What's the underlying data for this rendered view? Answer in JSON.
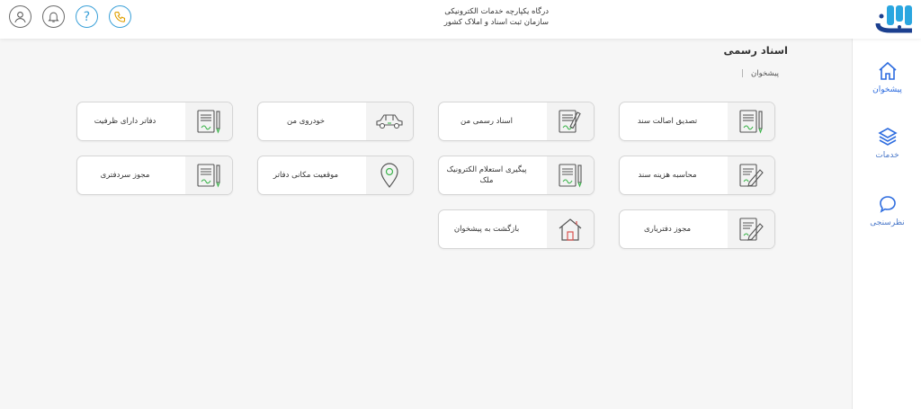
{
  "header": {
    "title_line1": "درگاه یکپارچه خدمات الکترونیکی",
    "title_line2": "سازمان ثبت اسناد و املاک کشور",
    "icons": [
      "user-icon",
      "bell-icon",
      "help-icon",
      "phone-icon"
    ]
  },
  "sidebar": {
    "items": [
      {
        "label": "پیشخوان",
        "icon": "home-icon"
      },
      {
        "label": "خدمات",
        "icon": "layers-icon"
      },
      {
        "label": "نظرسنجی",
        "icon": "chat-icon"
      }
    ]
  },
  "page": {
    "title": "اسناد رسمی",
    "breadcrumb": "پیشخوان"
  },
  "cards": [
    {
      "label": "تصدیق اصالت سند",
      "icon": "document-pen-icon"
    },
    {
      "label": "اسناد رسمی من",
      "icon": "document-pen-icon"
    },
    {
      "label": "خودروی من",
      "icon": "car-icon"
    },
    {
      "label": "دفاتر دارای ظرفیت",
      "icon": "document-pen-icon"
    },
    {
      "label": "محاسبه هزینه سند",
      "icon": "document-edit-icon"
    },
    {
      "label": "پیگیری استعلام الکترونیک ملک",
      "icon": "document-pen-icon"
    },
    {
      "label": "موقعیت مکانی دفاتر",
      "icon": "map-pin-icon"
    },
    {
      "label": "مجوز سردفتری",
      "icon": "document-pen-icon"
    },
    {
      "label": "مجوز دفتریاری",
      "icon": "document-edit-icon"
    },
    {
      "label": "بازگشت به پیشخوان",
      "icon": "house-icon"
    }
  ],
  "colors": {
    "accent": "#2d6cdf",
    "icon_green": "#3cb44b",
    "card_border": "#d5d5d5",
    "background": "#f6f6f6"
  }
}
